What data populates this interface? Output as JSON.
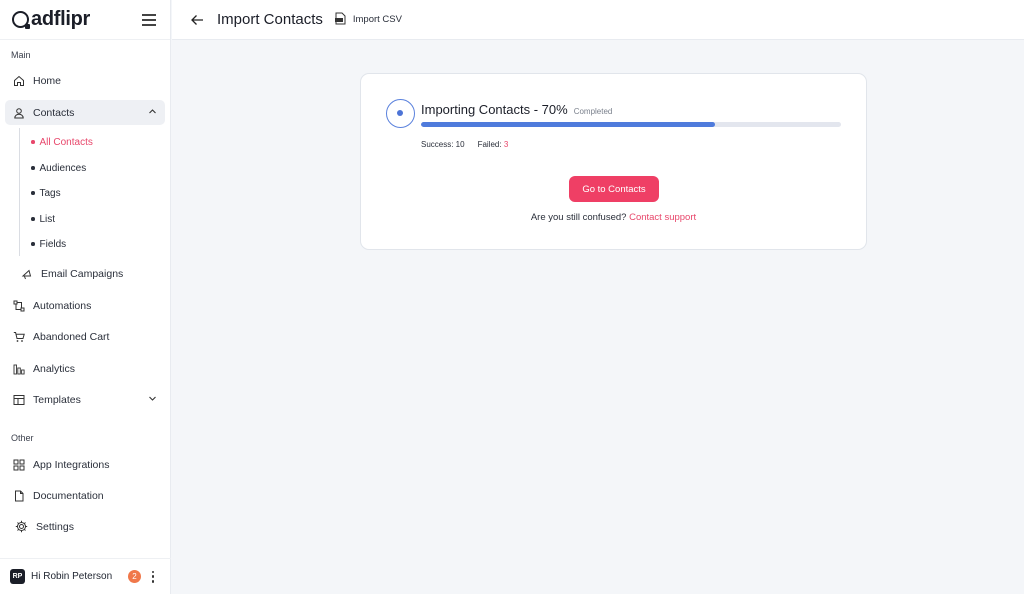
{
  "brand": {
    "name": "adflipr"
  },
  "sidebar": {
    "main_label": "Main",
    "other_label": "Other",
    "items": {
      "home": "Home",
      "contacts": "Contacts",
      "email_campaigns": "Email Campaigns",
      "automations": "Automations",
      "abandoned_cart": "Abandoned Cart",
      "analytics": "Analytics",
      "templates": "Templates",
      "app_integrations": "App Integrations",
      "documentation": "Documentation",
      "settings": "Settings"
    },
    "contacts_sub": {
      "all_contacts": "All Contacts",
      "audiences": "Audiences",
      "tags": "Tags",
      "list": "List",
      "fields": "Fields"
    },
    "user": {
      "initials": "RP",
      "greeting": "Hi Robin Peterson",
      "notifications": "2"
    }
  },
  "header": {
    "title": "Import Contacts",
    "crumb": "Import CSV"
  },
  "import": {
    "title": "Importing Contacts - 70%",
    "status": "Completed",
    "progress_percent": 70,
    "success_label": "Success: 10",
    "failed_label": "Failed:",
    "failed_count": "3",
    "cta_label": "Go to Contacts",
    "help_text": "Are you still confused?",
    "help_link": "Contact support"
  },
  "colors": {
    "accent": "#ef3f65",
    "progress": "#4f7bdc",
    "active_link": "#e8476b"
  }
}
